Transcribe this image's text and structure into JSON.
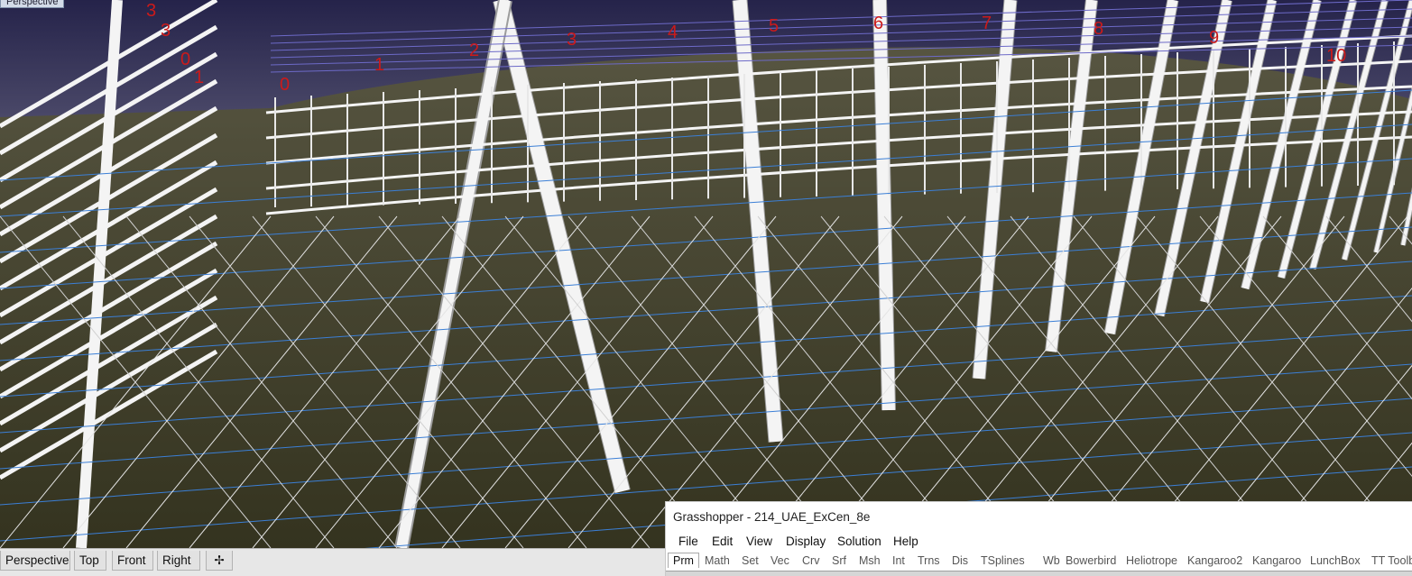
{
  "viewport": {
    "title": "Perspective",
    "level_labels": [
      "0",
      "1",
      "2",
      "3",
      "4",
      "5",
      "6",
      "7",
      "8",
      "9",
      "10",
      "3",
      "3",
      "0",
      "1"
    ]
  },
  "viewport_tabs": [
    {
      "label": "Perspective",
      "active": true
    },
    {
      "label": "Top",
      "active": false
    },
    {
      "label": "Front",
      "active": false
    },
    {
      "label": "Right",
      "active": false
    }
  ],
  "add_tab_icon": "plus-icon",
  "grasshopper": {
    "title": "Grasshopper - 214_UAE_ExCen_8e",
    "menu": [
      "File",
      "Edit",
      "View",
      "Display",
      "Solution",
      "Help"
    ],
    "tabs": [
      "Prm",
      "Math",
      "Set",
      "Vec",
      "Crv",
      "Srf",
      "Msh",
      "Int",
      "Trns",
      "Dis",
      "TSplines",
      "Wb",
      "Bowerbird",
      "Heliotrope",
      "Kangaroo2",
      "Kangaroo",
      "LunchBox",
      "TT Toolbox"
    ],
    "active_tab": "Prm"
  },
  "colors": {
    "sky": "#2c2a52",
    "ground": "#4f4c3a",
    "structure": "#f4f4f4",
    "guide_blue": "#3b7fd6",
    "label_red": "#cc1a1a"
  }
}
